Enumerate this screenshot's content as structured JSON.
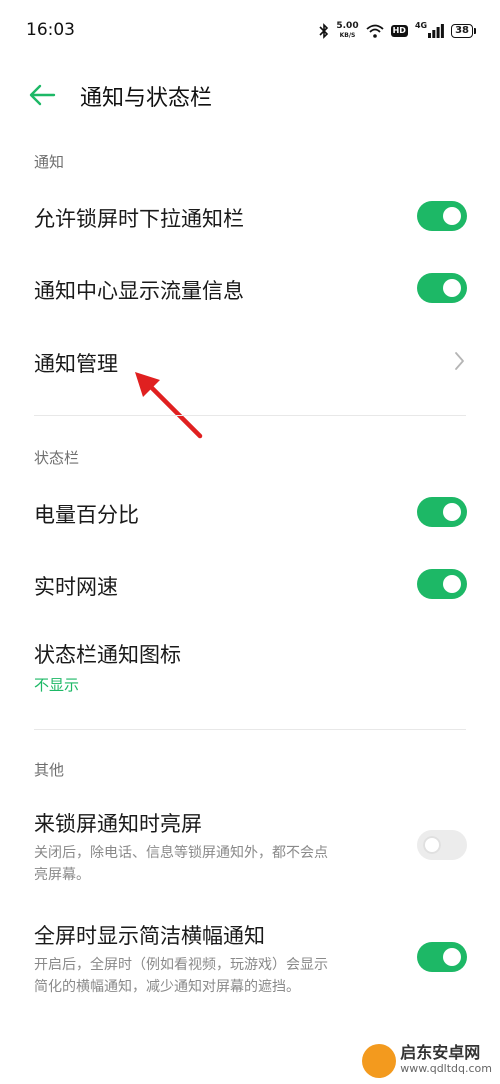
{
  "status_bar": {
    "time": "16:03",
    "speed_value": "5.00",
    "speed_unit": "KB/S",
    "hd_badge": "HD",
    "network": "4G",
    "battery": "38"
  },
  "header": {
    "title": "通知与状态栏"
  },
  "sections": {
    "notification": {
      "heading": "通知",
      "lock_pulldown": {
        "label": "允许锁屏时下拉通知栏",
        "on": true
      },
      "traffic_info": {
        "label": "通知中心显示流量信息",
        "on": true
      },
      "manage": {
        "label": "通知管理"
      }
    },
    "status_bar": {
      "heading": "状态栏",
      "battery_percent": {
        "label": "电量百分比",
        "on": true
      },
      "net_speed": {
        "label": "实时网速",
        "on": true
      },
      "notif_icons": {
        "label": "状态栏通知图标",
        "value": "不显示"
      }
    },
    "other": {
      "heading": "其他",
      "wake_screen": {
        "label": "来锁屏通知时亮屏",
        "desc_line1": "关闭后，除电话、信息等锁屏通知外，都不会点",
        "desc_line2": "亮屏幕。",
        "on": false
      },
      "banner": {
        "label": "全屏时显示简洁横幅通知",
        "desc_line1": "开启后，全屏时（例如看视频，玩游戏）会显示",
        "desc_line2": "简化的横幅通知，减少通知对屏幕的遮挡。",
        "on": true
      }
    }
  },
  "watermark": {
    "name": "启东安卓网",
    "url": "www.qdltdq.com"
  },
  "colors": {
    "accent": "#1db866",
    "annotation": "#e02020"
  }
}
